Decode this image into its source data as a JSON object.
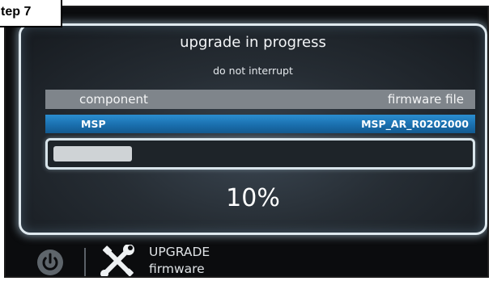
{
  "step_label": "tep 7",
  "screen": {
    "title": "upgrade in progress",
    "subtitle": "do not interrupt",
    "table": {
      "headers": [
        "component",
        "firmware file"
      ],
      "rows": [
        {
          "component": "MSP",
          "firmware_file": "MSP_AR_R0202000"
        }
      ]
    },
    "progress": {
      "fraction": 0.19,
      "percent_text": "10%"
    }
  },
  "bottom_bar": {
    "power_icon": "power-icon",
    "tools_icon": "wrench-screwdriver-icon",
    "line1": "UPGRADE",
    "line2": "firmware"
  },
  "colors": {
    "frame_glow": "#dfe9ef",
    "table_header_bg": "#7f858b",
    "selected_row_bg": "#1a6fae",
    "progress_fill": "#cfd3d6"
  }
}
